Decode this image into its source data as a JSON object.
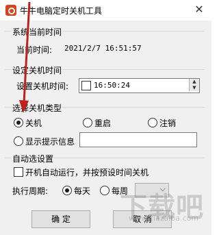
{
  "window": {
    "title": "牛牛电脑定时关机工具",
    "close_glyph": "✕"
  },
  "current_time": {
    "group_title": "系统当前时间",
    "label": "当前时间:",
    "value": "2021/2/7 16:51:57"
  },
  "shutdown_time": {
    "group_title": "设定关机时间",
    "label": "设置关机时间:",
    "value": "16:50:24",
    "spin_up": "▲",
    "spin_down": "▼"
  },
  "shutdown_type": {
    "group_title": "选择关机类型",
    "options": [
      "关机",
      "重启",
      "注销"
    ],
    "selected": "关机",
    "message_label": "显示提示信息",
    "message_value": ""
  },
  "auto": {
    "group_title": "自动选设置",
    "autostart_label": "开机自动运行，并按预设时间关机",
    "period_label": "执行周期:",
    "period_options": [
      "每天",
      "每周"
    ],
    "period_selected": "每天",
    "weekday_value": ""
  },
  "buttons": {
    "ok": "确 定",
    "cancel": "取 消"
  },
  "watermark": {
    "main": "下载吧",
    "sub": "www.xiazaiba.com"
  },
  "colors": {
    "app_icon": "#d9421c",
    "arrow": "#c0211b",
    "client_bg": "#f0f0f0"
  }
}
